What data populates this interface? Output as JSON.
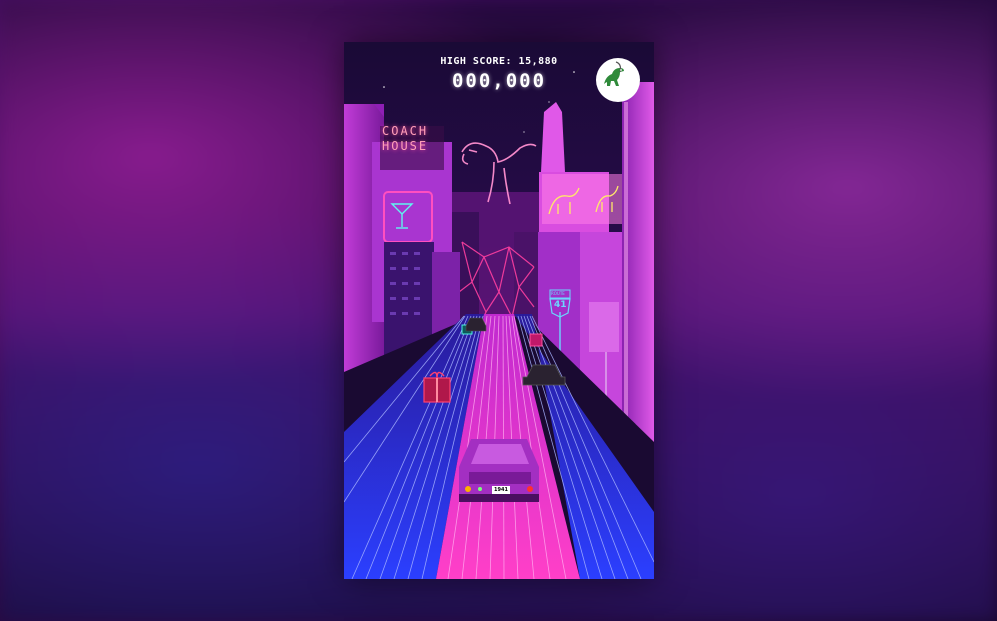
{
  "hud": {
    "high_score_label": "HIGH SCORE: 15,880",
    "score": "000,000"
  },
  "scene": {
    "sign_line1": "COACH",
    "sign_line2": "HOUSE",
    "route_label": "ROUTE",
    "route_number": "41",
    "plate": "1941"
  },
  "icons": {
    "mascot": "dinosaur-icon"
  },
  "colors": {
    "neon_pink": "#ff3fc8",
    "neon_blue": "#3b4cff",
    "neon_green": "#5cff9a"
  }
}
